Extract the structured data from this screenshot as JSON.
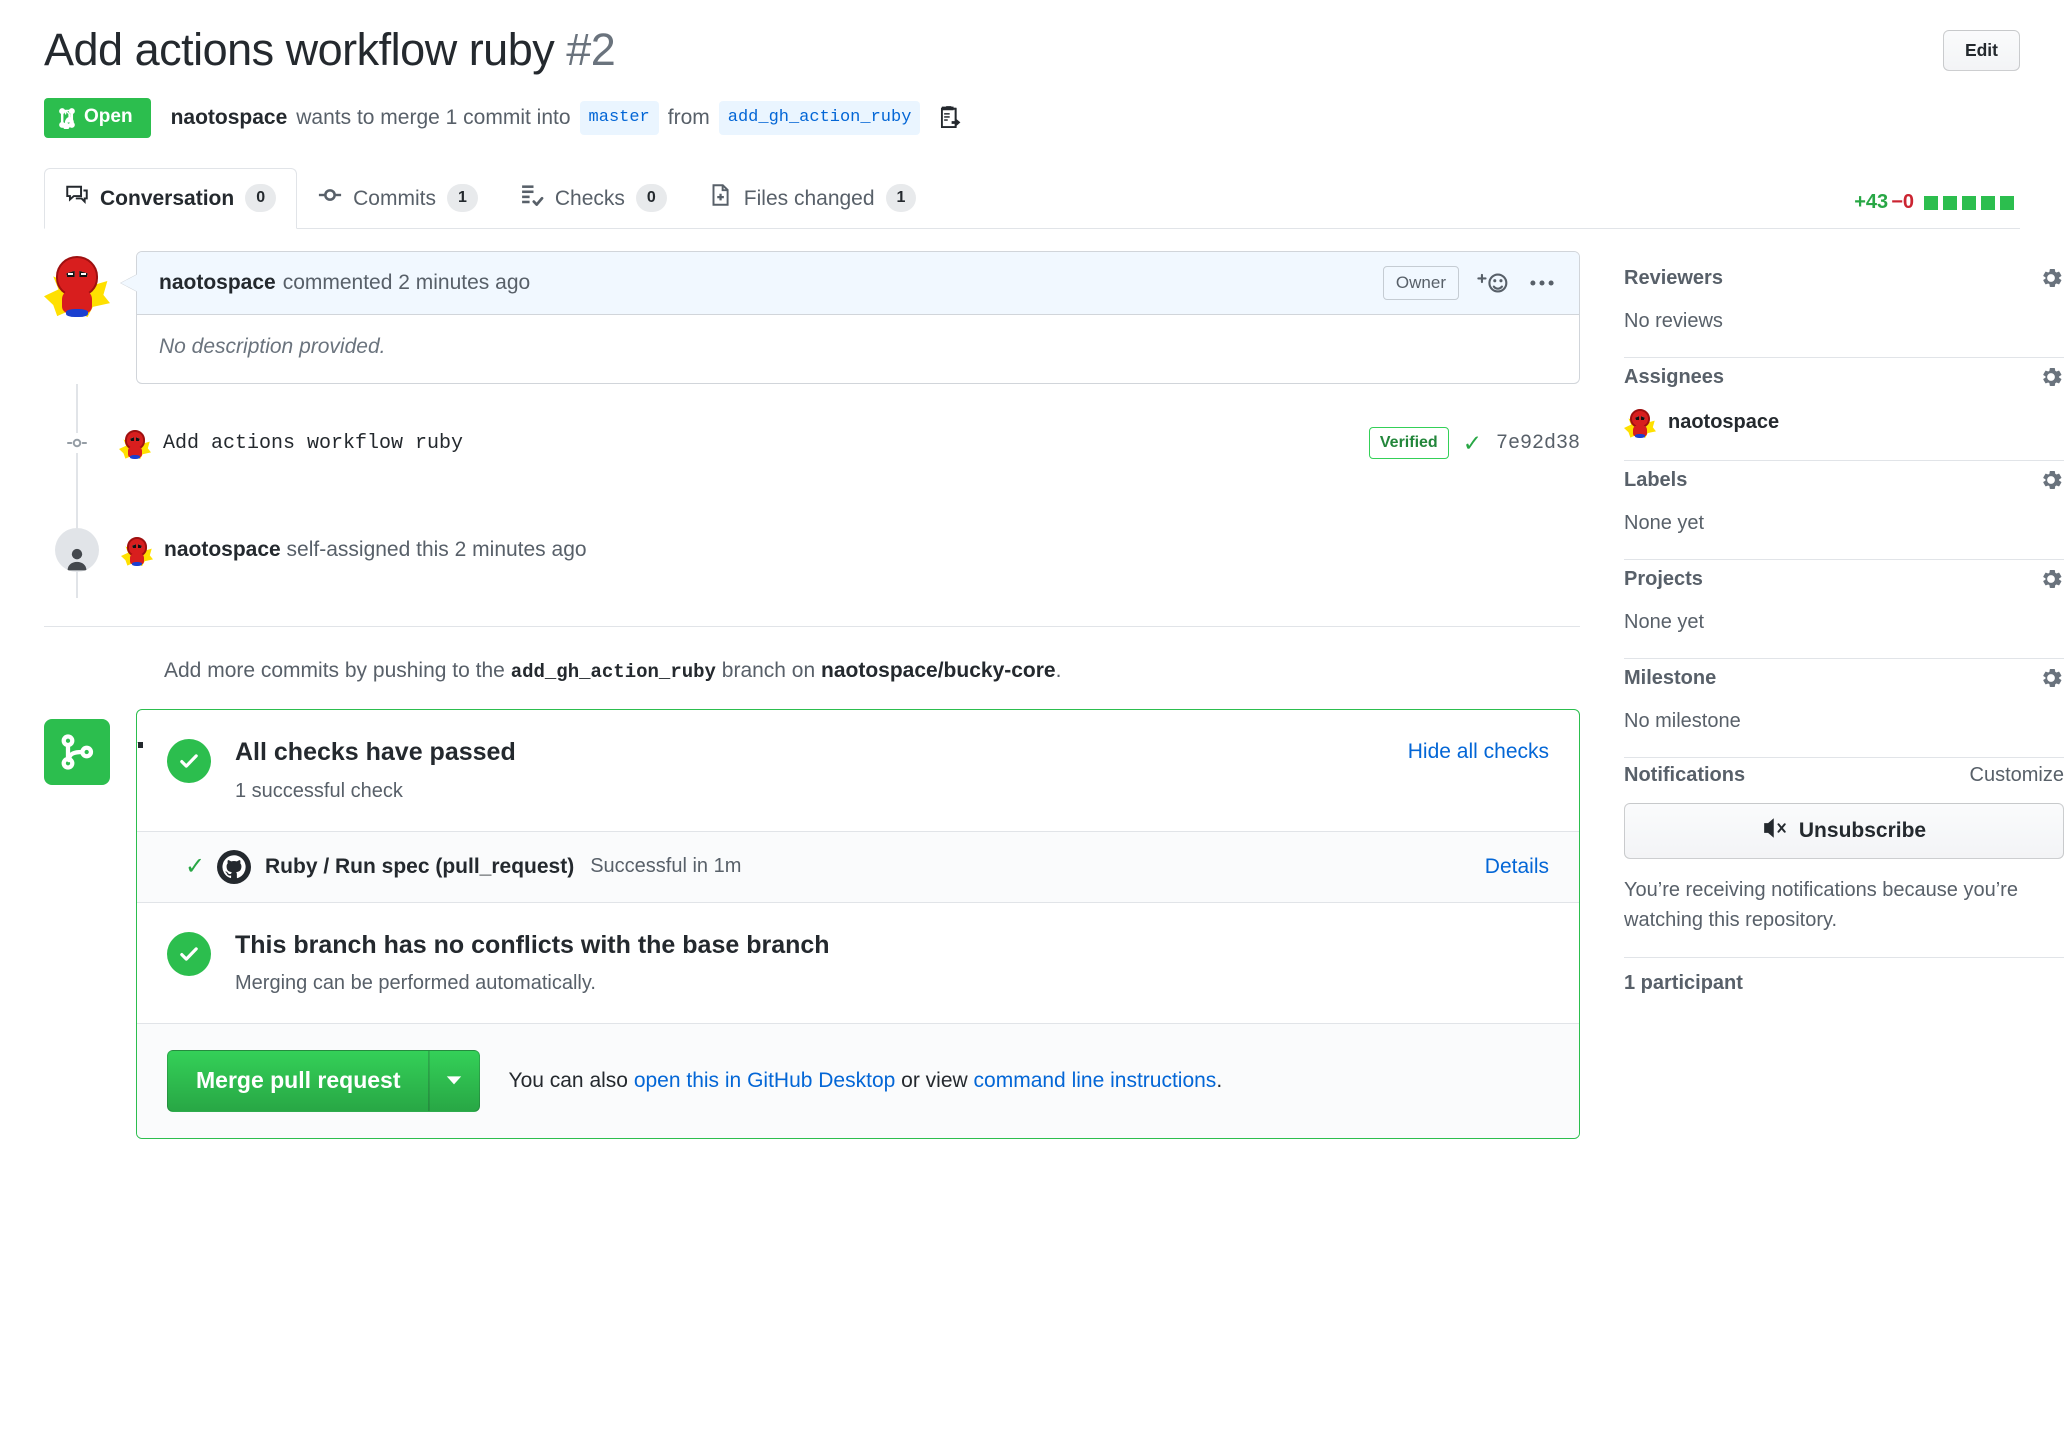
{
  "header": {
    "title": "Add actions workflow ruby",
    "number": "#2",
    "edit_label": "Edit",
    "state": "Open",
    "author": "naotospace",
    "meta_prefix": "wants to merge 1 commit into",
    "base_branch": "master",
    "meta_from": "from",
    "head_branch": "add_gh_action_ruby",
    "copy_icon": "copy-branch-icon"
  },
  "tabs": [
    {
      "label": "Conversation",
      "count": "0",
      "icon": "comment-discussion-icon",
      "selected": true
    },
    {
      "label": "Commits",
      "count": "1",
      "icon": "git-commit-icon",
      "selected": false
    },
    {
      "label": "Checks",
      "count": "0",
      "icon": "checklist-icon",
      "selected": false
    },
    {
      "label": "Files changed",
      "count": "1",
      "icon": "file-diff-icon",
      "selected": false
    }
  ],
  "diffstat": {
    "added": "+43",
    "deleted": "−0",
    "blocks": 5,
    "added_color": "#28a745",
    "deleted_color": "#cb2431",
    "block_color": "#2cbe4e"
  },
  "comment": {
    "author": "naotospace",
    "action": "commented 2 minutes ago",
    "badge": "Owner",
    "body": "No description provided.",
    "reaction_icon": "add-reaction-icon",
    "menu_icon": "kebab-horizontal-icon"
  },
  "timeline": {
    "commit": {
      "message": "Add actions workflow ruby",
      "verified": "Verified",
      "sha": "7e92d38",
      "check_icon": "check-icon"
    },
    "event": {
      "author": "naotospace",
      "text": "self-assigned this",
      "timestamp": "2 minutes ago"
    },
    "push_note": {
      "prefix": "Add more commits by pushing to the",
      "branch": "add_gh_action_ruby",
      "middle": "branch on",
      "repo": "naotospace/bucky-core",
      "suffix": "."
    }
  },
  "merge_box": {
    "icon": "git-merge-icon",
    "accent_color": "#2cbe4e",
    "checks": {
      "title": "All checks have passed",
      "subtitle": "1 successful check",
      "toggle_label": "Hide all checks"
    },
    "check_run": {
      "status_icon": "check-icon",
      "provider_icon": "github-actions-icon",
      "name": "Ruby / Run spec (pull_request)",
      "status": "Successful in 1m",
      "details_label": "Details"
    },
    "conflicts": {
      "title": "This branch has no conflicts with the base branch",
      "subtitle": "Merging can be performed automatically."
    },
    "actions": {
      "merge_label": "Merge pull request",
      "caret_icon": "triangle-down-icon",
      "note_prefix": "You can also",
      "link_desktop": "open this in GitHub Desktop",
      "note_middle": "or view",
      "link_cli": "command line instructions",
      "note_suffix": "."
    }
  },
  "sidebar": {
    "reviewers": {
      "title": "Reviewers",
      "gear": "gear-icon",
      "empty": "No reviews"
    },
    "assignees": {
      "title": "Assignees",
      "gear": "gear-icon",
      "person": "naotospace"
    },
    "labels": {
      "title": "Labels",
      "gear": "gear-icon",
      "empty": "None yet"
    },
    "projects": {
      "title": "Projects",
      "gear": "gear-icon",
      "empty": "None yet"
    },
    "milestone": {
      "title": "Milestone",
      "gear": "gear-icon",
      "empty": "No milestone"
    },
    "notifications": {
      "title": "Notifications",
      "customize": "Customize",
      "button": "Unsubscribe",
      "button_icon": "mute-icon",
      "note": "You’re receiving notifications because you’re watching this repository."
    },
    "participants": {
      "title": "1 participant"
    }
  }
}
